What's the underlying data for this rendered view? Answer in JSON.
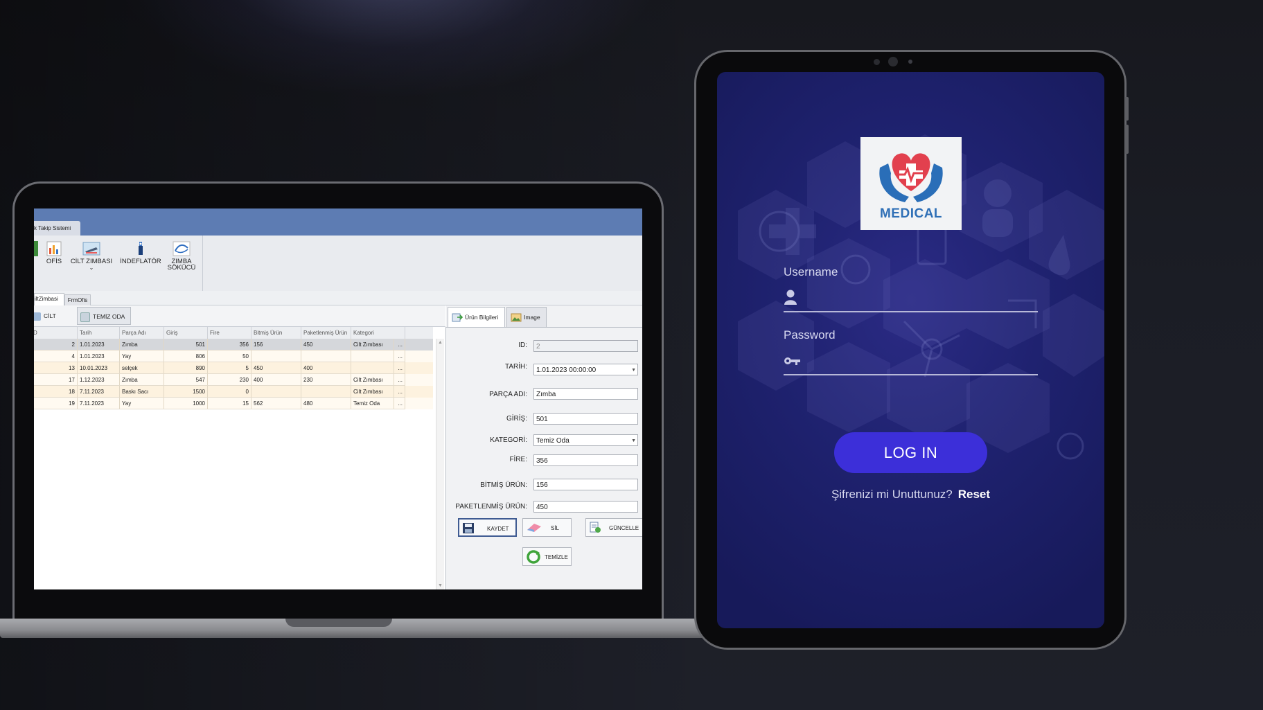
{
  "desktop_app": {
    "title": "k Takip Sistemi",
    "ribbon": [
      {
        "label": "OFİS",
        "icon": "chart-icon"
      },
      {
        "label": "CİLT ZIMBASI",
        "icon": "stapler-icon"
      },
      {
        "label": "İNDEFLATÖR",
        "icon": "inflator-icon"
      },
      {
        "label": "ZIMBA",
        "label2": "SÖKÜCÜ",
        "icon": "staple-remover-icon"
      }
    ],
    "ribbon_chevron": "⌄",
    "doc_tabs": [
      "iltZimbasi",
      "FrmOfis"
    ],
    "sub_tabs": [
      "CİLT ZIMBASI",
      "TEMİZ ODA"
    ],
    "grid": {
      "columns": [
        "D",
        "Tarih",
        "Parça Adı",
        "Giriş",
        "Fire",
        "Bitmiş Ürün",
        "Paketlenmiş Ürün",
        "Kategori"
      ],
      "rows": [
        {
          "id": "2",
          "tarih": "1.01.2023",
          "parca": "Zımba",
          "giris": "501",
          "fire": "356",
          "bitmis": "156",
          "paket": "450",
          "kategori": "Cilt Zımbası",
          "more": "..."
        },
        {
          "id": "4",
          "tarih": "1.01.2023",
          "parca": "Yay",
          "giris": "806",
          "fire": "50",
          "bitmis": "",
          "paket": "",
          "kategori": "",
          "more": "..."
        },
        {
          "id": "13",
          "tarih": "10.01.2023",
          "parca": "selçek",
          "giris": "890",
          "fire": "5",
          "bitmis": "450",
          "paket": "400",
          "kategori": "",
          "more": "..."
        },
        {
          "id": "17",
          "tarih": "1.12.2023",
          "parca": "Zımba",
          "giris": "547",
          "fire": "230",
          "bitmis": "400",
          "paket": "230",
          "kategori": "Cilt Zımbası",
          "more": "..."
        },
        {
          "id": "18",
          "tarih": "7.11.2023",
          "parca": "Baskı Sacı",
          "giris": "1500",
          "fire": "0",
          "bitmis": "",
          "paket": "",
          "kategori": "Cilt Zımbası",
          "more": "..."
        },
        {
          "id": "19",
          "tarih": "7.11.2023",
          "parca": "Yay",
          "giris": "1000",
          "fire": "15",
          "bitmis": "562",
          "paket": "480",
          "kategori": "Temiz Oda",
          "more": "..."
        }
      ]
    },
    "panel": {
      "tabs": [
        "Ürün Bilgileri",
        "Image"
      ],
      "fields": {
        "id": {
          "label": "ID:",
          "value": "2"
        },
        "tarih": {
          "label": "TARİH:",
          "value": "1.01.2023 00:00:00"
        },
        "parca": {
          "label": "PARÇA ADI:",
          "value": "Zımba"
        },
        "giris": {
          "label": "GİRİŞ:",
          "value": "501"
        },
        "kategori": {
          "label": "KATEGORİ:",
          "value": "Temiz Oda"
        },
        "fire": {
          "label": "FİRE:",
          "value": "356"
        },
        "bitmis": {
          "label": "BİTMİŞ ÜRÜN:",
          "value": "156"
        },
        "paket": {
          "label": "PAKETLENMİŞ ÜRÜN:",
          "value": "450"
        }
      },
      "buttons": {
        "kaydet": "KAYDET",
        "sil": "SİL",
        "guncelle": "GÜNCELLE",
        "temizle": "TEMİZLE"
      }
    }
  },
  "mobile_app": {
    "logo_text": "MEDICAL",
    "username_label": "Username",
    "password_label": "Password",
    "login_button": "LOG IN",
    "forgot_text": "Şifrenizi mi Unuttunuz?",
    "reset_link": "Reset",
    "colors": {
      "primary": "#3c2fd9",
      "background": "#1f2270"
    }
  }
}
